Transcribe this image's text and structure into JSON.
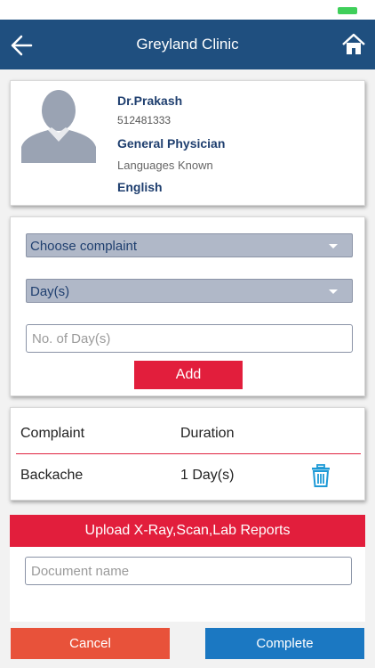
{
  "header": {
    "title": "Greyland Clinic",
    "back_icon": "back-arrow-icon",
    "home_icon": "home-icon"
  },
  "doctor": {
    "name": "Dr.Prakash",
    "id": "512481333",
    "specialty": "General Physician",
    "languages_label": "Languages Known",
    "languages_value": "English"
  },
  "complaint_form": {
    "complaint_select": "Choose complaint",
    "duration_unit_select": "Day(s)",
    "days_placeholder": "No. of Day(s)",
    "add_label": "Add"
  },
  "complaints_table": {
    "columns": [
      "Complaint",
      "Duration"
    ],
    "rows": [
      {
        "complaint": "Backache",
        "duration": "1 Day(s)"
      }
    ]
  },
  "upload": {
    "title": "Upload X-Ray,Scan,Lab Reports",
    "doc_placeholder": "Document name"
  },
  "actions": {
    "cancel_label": "Cancel",
    "complete_label": "Complete"
  },
  "colors": {
    "header_bg": "#1f4f7f",
    "accent_red": "#e21e3c",
    "cancel_bg": "#e8523a",
    "complete_bg": "#1b78c2"
  }
}
